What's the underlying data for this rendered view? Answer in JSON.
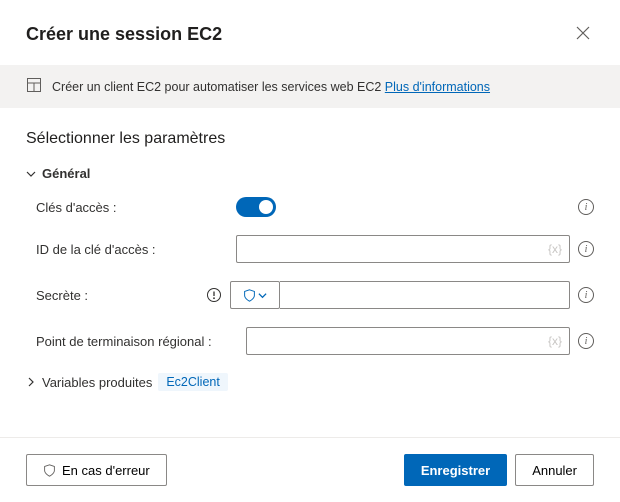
{
  "header": {
    "title": "Créer une session EC2"
  },
  "banner": {
    "text": "Créer un client EC2 pour automatiser les services web EC2 ",
    "link": "Plus d'informations"
  },
  "section_title": "Sélectionner les paramètres",
  "group_general": "Général",
  "fields": {
    "access_keys_label": "Clés d'accès :",
    "access_key_id_label": "ID de la clé d'accès :",
    "access_key_id_value": "",
    "secret_label": "Secrète :",
    "secret_value": "",
    "endpoint_label": "Point de terminaison régional :",
    "endpoint_value": "",
    "var_hint": "{x}"
  },
  "variables": {
    "label": "Variables produites",
    "tag": "Ec2Client"
  },
  "footer": {
    "on_error": "En cas d'erreur",
    "save": "Enregistrer",
    "cancel": "Annuler"
  }
}
